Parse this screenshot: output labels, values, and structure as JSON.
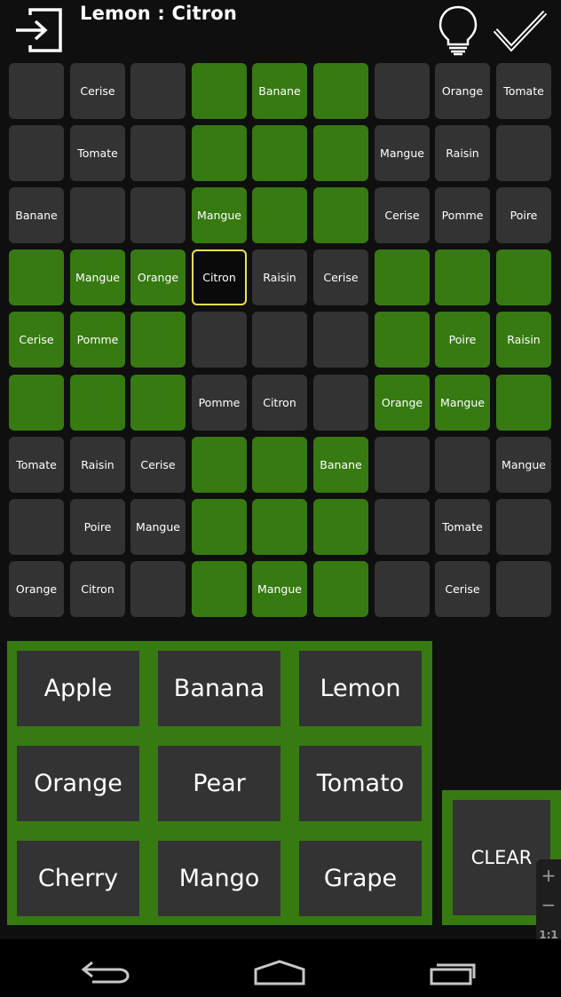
{
  "header": {
    "title": "Lemon : Citron"
  },
  "grid": {
    "rows": [
      [
        {
          "text": "",
          "green": false
        },
        {
          "text": "Cerise",
          "green": false
        },
        {
          "text": "",
          "green": false
        },
        {
          "text": "",
          "green": true
        },
        {
          "text": "Banane",
          "green": true
        },
        {
          "text": "",
          "green": true
        },
        {
          "text": "",
          "green": false
        },
        {
          "text": "Orange",
          "green": false
        },
        {
          "text": "Tomate",
          "green": false
        }
      ],
      [
        {
          "text": "",
          "green": false
        },
        {
          "text": "Tomate",
          "green": false
        },
        {
          "text": "",
          "green": false
        },
        {
          "text": "",
          "green": true
        },
        {
          "text": "",
          "green": true
        },
        {
          "text": "",
          "green": true
        },
        {
          "text": "Mangue",
          "green": false
        },
        {
          "text": "Raisin",
          "green": false
        },
        {
          "text": "",
          "green": false
        }
      ],
      [
        {
          "text": "Banane",
          "green": false
        },
        {
          "text": "",
          "green": false
        },
        {
          "text": "",
          "green": false
        },
        {
          "text": "Mangue",
          "green": true
        },
        {
          "text": "",
          "green": true
        },
        {
          "text": "",
          "green": true
        },
        {
          "text": "Cerise",
          "green": false
        },
        {
          "text": "Pomme",
          "green": false
        },
        {
          "text": "Poire",
          "green": false
        }
      ],
      [
        {
          "text": "",
          "green": true
        },
        {
          "text": "Mangue",
          "green": true
        },
        {
          "text": "Orange",
          "green": true
        },
        {
          "text": "Citron",
          "green": false,
          "selected": true
        },
        {
          "text": "Raisin",
          "green": false
        },
        {
          "text": "Cerise",
          "green": false
        },
        {
          "text": "",
          "green": true
        },
        {
          "text": "",
          "green": true
        },
        {
          "text": "",
          "green": true
        }
      ],
      [
        {
          "text": "Cerise",
          "green": true
        },
        {
          "text": "Pomme",
          "green": true
        },
        {
          "text": "",
          "green": true
        },
        {
          "text": "",
          "green": false
        },
        {
          "text": "",
          "green": false
        },
        {
          "text": "",
          "green": false
        },
        {
          "text": "",
          "green": true
        },
        {
          "text": "Poire",
          "green": true
        },
        {
          "text": "Raisin",
          "green": true
        }
      ],
      [
        {
          "text": "",
          "green": true
        },
        {
          "text": "",
          "green": true
        },
        {
          "text": "",
          "green": true
        },
        {
          "text": "Pomme",
          "green": false
        },
        {
          "text": "Citron",
          "green": false
        },
        {
          "text": "",
          "green": false
        },
        {
          "text": "Orange",
          "green": true
        },
        {
          "text": "Mangue",
          "green": true
        },
        {
          "text": "",
          "green": true
        }
      ],
      [
        {
          "text": "Tomate",
          "green": false
        },
        {
          "text": "Raisin",
          "green": false
        },
        {
          "text": "Cerise",
          "green": false
        },
        {
          "text": "",
          "green": true
        },
        {
          "text": "",
          "green": true
        },
        {
          "text": "Banane",
          "green": true
        },
        {
          "text": "",
          "green": false
        },
        {
          "text": "",
          "green": false
        },
        {
          "text": "Mangue",
          "green": false
        }
      ],
      [
        {
          "text": "",
          "green": false
        },
        {
          "text": "Poire",
          "green": false
        },
        {
          "text": "Mangue",
          "green": false
        },
        {
          "text": "",
          "green": true
        },
        {
          "text": "",
          "green": true
        },
        {
          "text": "",
          "green": true
        },
        {
          "text": "",
          "green": false
        },
        {
          "text": "Tomate",
          "green": false
        },
        {
          "text": "",
          "green": false
        }
      ],
      [
        {
          "text": "Orange",
          "green": false
        },
        {
          "text": "Citron",
          "green": false
        },
        {
          "text": "",
          "green": false
        },
        {
          "text": "",
          "green": true
        },
        {
          "text": "Mangue",
          "green": true
        },
        {
          "text": "",
          "green": true
        },
        {
          "text": "",
          "green": false
        },
        {
          "text": "Cerise",
          "green": false
        },
        {
          "text": "",
          "green": false
        }
      ]
    ]
  },
  "palette": {
    "words": [
      "Apple",
      "Banana",
      "Lemon",
      "Orange",
      "Pear",
      "Tomato",
      "Cherry",
      "Mango",
      "Grape"
    ],
    "clear_label": "CLEAR"
  },
  "zoom": {
    "plus": "+",
    "minus": "−",
    "one_to_one": "1:1"
  },
  "icons": {
    "exit": "exit-icon",
    "hint": "lightbulb-icon",
    "submit": "checkmark-icon",
    "fit": "fit-screen-icon",
    "nav_back": "back-icon",
    "nav_home": "home-icon",
    "nav_recents": "recents-icon"
  },
  "colors": {
    "green": "#367a11",
    "cell": "#333333",
    "selected_border": "#f0e050",
    "background": "#0f0f0f"
  }
}
